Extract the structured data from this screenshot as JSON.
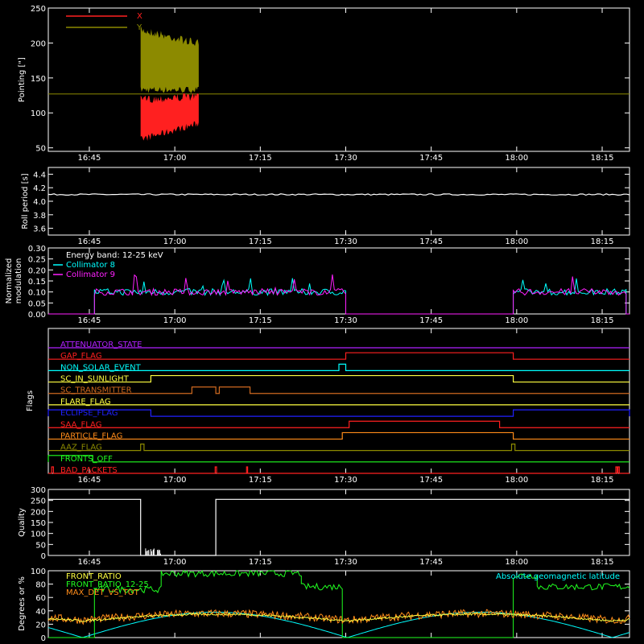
{
  "colors": {
    "background": "#000000",
    "axes": "#ffffff",
    "red": "#ff2020",
    "olive": "#8c8a00",
    "cyan": "#00ffff",
    "magenta": "#ff20ff",
    "green": "#20ff20",
    "orange": "#ff8c1a",
    "yellow": "#ffff40",
    "blue": "#2020ff",
    "purple": "#b020ff",
    "brown": "#d06a20"
  },
  "time_ticks": [
    "16:45",
    "17:00",
    "17:15",
    "17:30",
    "17:45",
    "18:00",
    "18:15"
  ],
  "chart_data": [
    {
      "id": "pointing",
      "type": "line",
      "ylabel": "Pointing [\"]",
      "ylim": [
        45,
        250
      ],
      "yticks": [
        50,
        100,
        150,
        200,
        250
      ],
      "series": [
        {
          "name": "X",
          "color": "#ff2020",
          "kind": "band",
          "t": [
            16.9,
            17.07
          ],
          "low": [
            57,
            80
          ],
          "high": [
            125,
            130
          ]
        },
        {
          "name": "Y",
          "color": "#8c8a00",
          "kind": "band",
          "t": [
            16.9,
            17.07
          ],
          "low": [
            128,
            128
          ],
          "high": [
            225,
            205
          ]
        },
        {
          "name": "",
          "color": "#8c8a00",
          "kind": "hline",
          "value": 127
        }
      ]
    },
    {
      "id": "roll",
      "type": "line",
      "ylabel": "Roll period [s]",
      "ylim": [
        3.5,
        4.5
      ],
      "yticks": [
        3.6,
        3.8,
        4.0,
        4.2,
        4.4
      ],
      "series": [
        {
          "name": "",
          "color": "#ffffff",
          "value": 4.1
        }
      ]
    },
    {
      "id": "modulation",
      "type": "line",
      "ylabel": "Normalized modulation",
      "ylim": [
        0,
        0.3
      ],
      "yticks": [
        0.0,
        0.05,
        0.1,
        0.15,
        0.2,
        0.25,
        0.3
      ],
      "annotation": "Energy band: 12-25 keV",
      "segments": [
        [
          16.765,
          17.5
        ],
        [
          17.99,
          18.32
        ]
      ],
      "series": [
        {
          "name": "Collimator 8",
          "color": "#00ffff",
          "level": 0.1
        },
        {
          "name": "Collimator 9",
          "color": "#ff20ff",
          "level": 0.1
        }
      ]
    },
    {
      "id": "flags",
      "type": "line",
      "ylabel": "Flags",
      "flags": [
        {
          "name": "ATTENUATOR_STATE",
          "color": "#b020ff",
          "on": []
        },
        {
          "name": "GAP_FLAG",
          "color": "#ff2020",
          "on": [
            [
              17.5,
              17.99
            ]
          ]
        },
        {
          "name": "NON_SOLAR_EVENT",
          "color": "#00ffff",
          "on": [
            [
              17.48,
              17.5
            ]
          ]
        },
        {
          "name": "SC_IN_SUNLIGHT",
          "color": "#ffff40",
          "on": [
            [
              16.93,
              17.99
            ]
          ]
        },
        {
          "name": "SC_TRANSMITTER",
          "color": "#d06a20",
          "on": [
            [
              17.05,
              17.12
            ],
            [
              17.13,
              17.22
            ]
          ]
        },
        {
          "name": "FLARE_FLAG",
          "color": "#ffff40",
          "on": []
        },
        {
          "name": "ECLIPSE_FLAG",
          "color": "#2020ff",
          "on": [
            [
              16.63,
              16.93
            ],
            [
              17.99,
              18.33
            ]
          ]
        },
        {
          "name": "SAA_FLAG",
          "color": "#ff2020",
          "on": [
            [
              17.51,
              17.95
            ]
          ]
        },
        {
          "name": "PARTICLE_FLAG",
          "color": "#ff8c1a",
          "on": [
            [
              17.49,
              17.99
            ]
          ]
        },
        {
          "name": "AAZ_FLAG",
          "color": "#8c8a00",
          "on": [
            [
              16.9,
              16.91
            ],
            [
              17.985,
              17.995
            ]
          ]
        },
        {
          "name": "FRONTS_OFF",
          "color": "#20ff20",
          "on": [
            [
              16.63,
              16.76
            ]
          ]
        },
        {
          "name": "BAD_PACKETS",
          "color": "#ff2020",
          "on": [
            [
              16.64,
              16.645
            ],
            [
              17.118,
              17.122
            ],
            [
              17.21,
              17.213
            ],
            [
              18.29,
              18.294
            ],
            [
              18.296,
              18.3
            ]
          ]
        }
      ]
    },
    {
      "id": "quality",
      "type": "line",
      "ylabel": "Quality",
      "ylim": [
        0,
        300
      ],
      "yticks": [
        0,
        50,
        100,
        150,
        200,
        250,
        300
      ],
      "series": [
        {
          "name": "",
          "color": "#ffffff",
          "steps": [
            [
              16.63,
              255
            ],
            [
              16.9,
              255
            ],
            [
              16.9,
              0
            ],
            [
              17.12,
              0
            ],
            [
              17.12,
              255
            ],
            [
              18.33,
              255
            ]
          ]
        }
      ]
    },
    {
      "id": "ratios",
      "type": "line",
      "ylabel": "Degrees or %",
      "ylim": [
        0,
        100
      ],
      "yticks": [
        0,
        20,
        40,
        60,
        80,
        100
      ],
      "series": [
        {
          "name": "FRONT_RATIO",
          "color": "#ffff40"
        },
        {
          "name": "FRONT_RATIO_12-25",
          "color": "#20ff20"
        },
        {
          "name": "MAX_DET_VS_TOT",
          "color": "#ff8c1a"
        },
        {
          "name": "Absolute geomagnetic latitude",
          "color": "#00ffff"
        }
      ],
      "front_ratio_segments": [
        {
          "t": [
            16.765,
            16.96
          ],
          "level": 72
        },
        {
          "t": [
            16.96,
            17.37
          ],
          "level": 96
        },
        {
          "t": [
            17.37,
            17.49
          ],
          "level": 76
        },
        {
          "t": [
            17.99,
            18.06
          ],
          "level": 93
        },
        {
          "t": [
            18.06,
            18.33
          ],
          "level": 76
        }
      ]
    }
  ]
}
